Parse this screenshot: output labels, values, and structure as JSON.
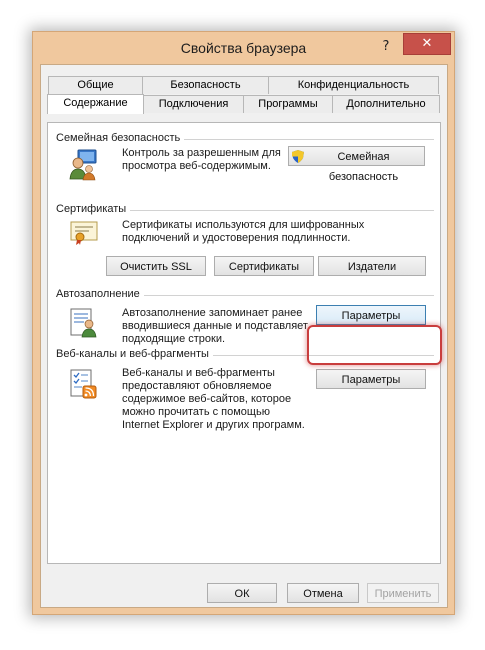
{
  "window": {
    "title": "Свойства браузера",
    "help_label": "?",
    "close_label": "✕"
  },
  "tabs": {
    "row1": [
      "Общие",
      "Безопасность",
      "Конфиденциальность"
    ],
    "row2": [
      "Содержание",
      "Подключения",
      "Программы",
      "Дополнительно"
    ],
    "active": "Содержание"
  },
  "family_safety": {
    "heading": "Семейная безопасность",
    "description_line1": "Контроль за разрешенным для",
    "description_line2": "просмотра веб-содержимым.",
    "button_label": "Семейная безопасность"
  },
  "certificates": {
    "heading": "Сертификаты",
    "description_line1": "Сертификаты используются для шифрованных",
    "description_line2": "подключений и удостоверения подлинности.",
    "clear_ssl_label": "Очистить SSL",
    "certificates_label": "Сертификаты",
    "publishers_label": "Издатели"
  },
  "autocomplete": {
    "heading": "Автозаполнение",
    "description_line1": "Автозаполнение запоминает ранее",
    "description_line2": "вводившиеся данные и подставляет",
    "description_line3": "подходящие строки.",
    "settings_label": "Параметры"
  },
  "feeds": {
    "heading": "Веб-каналы и веб-фрагменты",
    "description_line1": "Веб-каналы и веб-фрагменты",
    "description_line2": "предоставляют обновляемое",
    "description_line3": "содержимое веб-сайтов, которое",
    "description_line4": "можно прочитать с помощью",
    "description_line5": "Internet Explorer и других программ.",
    "settings_label": "Параметры"
  },
  "footer": {
    "ok_label": "ОК",
    "cancel_label": "Отмена",
    "apply_label": "Применить"
  },
  "colors": {
    "titlebar": "#f0c89e",
    "close_button": "#c7514a",
    "highlight": "#c93d3d"
  }
}
